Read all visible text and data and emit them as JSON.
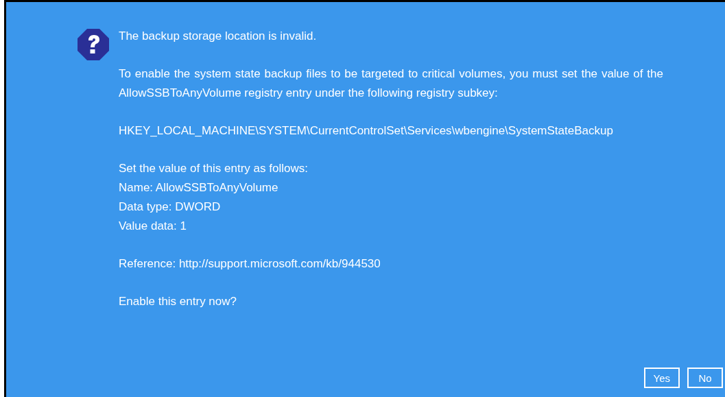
{
  "dialog": {
    "title": "The backup storage location is invalid.",
    "paragraphs": [
      {
        "kind": "justified",
        "lines": [
          "To enable the system state backup files to be targeted to critical volumes, you must set the value of the AllowSSBToAnyVolume registry entry under the following registry subkey:"
        ]
      },
      {
        "kind": "path",
        "lines": [
          "HKEY_LOCAL_MACHINE\\SYSTEM\\CurrentControlSet\\Services\\wbengine\\SystemStateBackup"
        ]
      },
      {
        "kind": "lines",
        "lines": [
          "Set the value of this entry as follows:",
          "Name: AllowSSBToAnyVolume",
          "Data type: DWORD",
          "Value data: 1"
        ]
      },
      {
        "kind": "lines",
        "lines": [
          "Reference: http://support.microsoft.com/kb/944530"
        ]
      },
      {
        "kind": "lines",
        "lines": [
          "Enable this entry now?"
        ]
      }
    ],
    "buttons": [
      "Yes",
      "No"
    ]
  }
}
